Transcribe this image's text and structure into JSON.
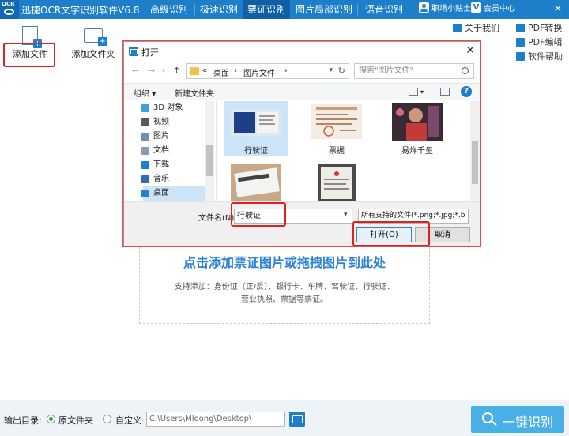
{
  "app": {
    "title": "迅捷OCR文字识别软件V6.8",
    "logo_text": "OCR"
  },
  "nav": {
    "tabs": [
      {
        "label": "高级识别",
        "active": false
      },
      {
        "label": "极速识别",
        "active": false
      },
      {
        "label": "票证识别",
        "active": true
      },
      {
        "label": "图片局部识别",
        "active": false
      },
      {
        "label": "语音识别",
        "active": false
      }
    ]
  },
  "title_right": {
    "user_label": "职场小贴士",
    "member_label": "会员中心",
    "vip_letter": "V"
  },
  "window_controls": {
    "minimize": "—",
    "close": "✕"
  },
  "toolbar": {
    "add_file": "添加文件",
    "add_folder": "添加文件夹",
    "about_us": "关于我们",
    "pdf_convert": "PDF转换",
    "pdf_edit": "PDF编辑",
    "help": "软件帮助"
  },
  "main": {
    "drop_title": "点击添加票证图片或拖拽图片到此处",
    "support_line1": "支持添加：身份证（正/反）、银行卡、车牌、驾驶证、行驶证、",
    "support_line2": "营业执照、票据等票证。"
  },
  "bottom": {
    "output_label": "输出目录:",
    "option_source": "原文件夹",
    "option_custom": "自定义",
    "path_value": "C:\\Users\\Mloong\\Desktop\\",
    "recognize_label": "一键识别"
  },
  "dialog": {
    "title": "打开",
    "close": "✕",
    "breadcrumb": [
      "«",
      "桌面",
      "›",
      "图片文件",
      "›"
    ],
    "search_placeholder": "搜索\"图片文件\"",
    "organize": "组织 ▾",
    "new_folder": "新建文件夹",
    "help": "?",
    "tree": [
      {
        "label": "3D 对象",
        "color": "#3aa0e0",
        "selected": false
      },
      {
        "label": "视频",
        "color": "#555b66",
        "selected": false
      },
      {
        "label": "图片",
        "color": "#6e8fb3",
        "selected": false
      },
      {
        "label": "文档",
        "color": "#8a9bb0",
        "selected": false
      },
      {
        "label": "下载",
        "color": "#1d7ec9",
        "selected": false
      },
      {
        "label": "音乐",
        "color": "#2f6db3",
        "selected": false
      },
      {
        "label": "桌面",
        "color": "#2a7fd0",
        "selected": true
      }
    ],
    "files": [
      {
        "name": "行驶证",
        "selected": true
      },
      {
        "name": "票据",
        "selected": false
      },
      {
        "name": "易烊千玺",
        "selected": false
      },
      {
        "name": "",
        "selected": false
      },
      {
        "name": "",
        "selected": false
      }
    ],
    "filename_label": "文件名(N):",
    "filename_value": "行驶证",
    "filter_value": "所有支持的文件(*.png;*.jpg;*.b",
    "open_button": "打开(O)",
    "cancel_button": "取消"
  }
}
